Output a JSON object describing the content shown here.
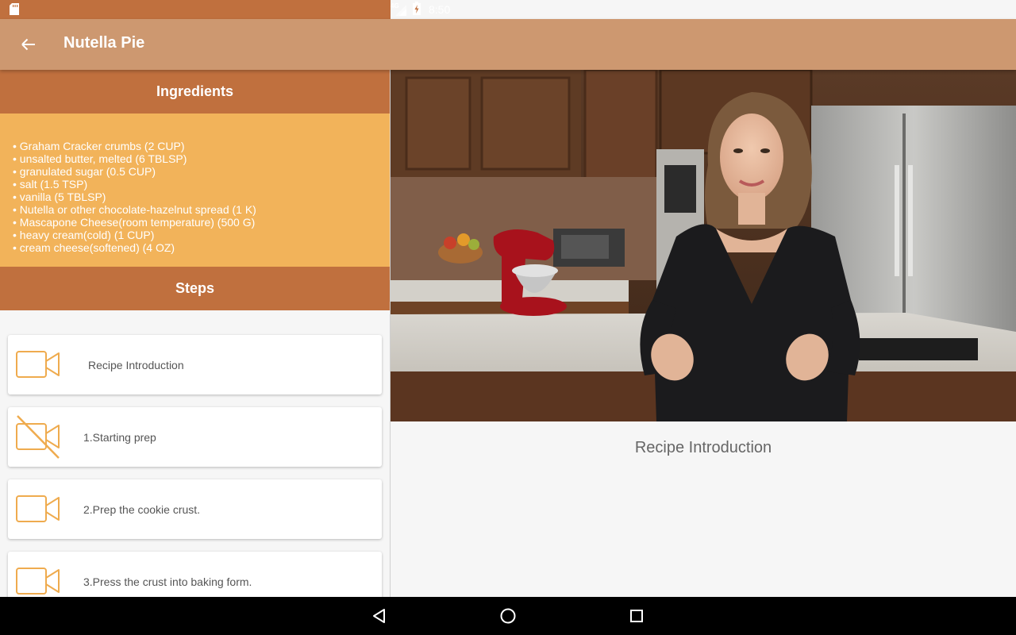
{
  "status_bar": {
    "time": "8:50",
    "network": "4G",
    "icons": [
      "sd-card-icon",
      "signal-icon",
      "battery-charging-icon"
    ]
  },
  "app_bar": {
    "title": "Nutella Pie",
    "back_icon": "arrow-back-icon"
  },
  "ingredients": {
    "header": "Ingredients",
    "items": [
      "• Graham Cracker crumbs (2 CUP)",
      "• unsalted butter, melted (6 TBLSP)",
      "• granulated sugar (0.5 CUP)",
      "• salt (1.5 TSP)",
      "• vanilla (5 TBLSP)",
      "• Nutella or other chocolate-hazelnut spread (1 K)",
      "• Mascapone Cheese(room temperature) (500 G)",
      "• heavy cream(cold) (1 CUP)",
      "• cream cheese(softened) (4 OZ)"
    ]
  },
  "steps": {
    "header": "Steps",
    "items": [
      {
        "label": "Recipe Introduction",
        "icon": "video-camera-icon"
      },
      {
        "label": "1.Starting prep",
        "icon": "video-camera-off-icon"
      },
      {
        "label": "2.Prep the cookie crust.",
        "icon": "video-camera-icon"
      },
      {
        "label": "3.Press the crust into baking form.",
        "icon": "video-camera-icon"
      }
    ]
  },
  "detail": {
    "description": "Recipe Introduction"
  },
  "colors": {
    "status_bar": "#c0703e",
    "app_bar": "#cd9870",
    "section_header": "#c0703e",
    "ingredients_bg": "#f2b35a",
    "camera_icon": "#efab4e"
  },
  "nav_bar": {
    "icons": [
      "back-triangle-icon",
      "home-circle-icon",
      "recents-square-icon"
    ]
  }
}
